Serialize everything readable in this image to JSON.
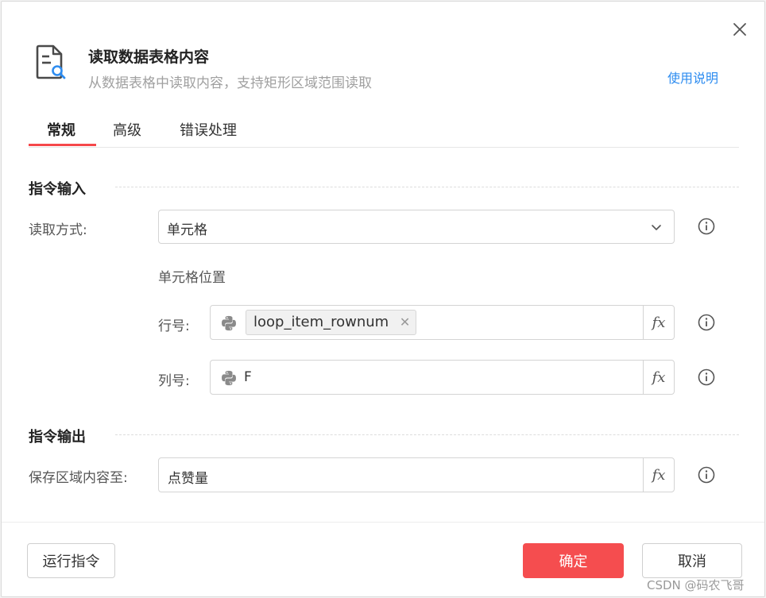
{
  "dialog": {
    "title": "读取数据表格内容",
    "subtitle": "从数据表格中读取内容，支持矩形区域范围读取",
    "help_link": "使用说明"
  },
  "tabs": [
    {
      "label": "常规",
      "active": true
    },
    {
      "label": "高级",
      "active": false
    },
    {
      "label": "错误处理",
      "active": false
    }
  ],
  "input_section": {
    "title": "指令输入",
    "read_mode": {
      "label": "读取方式:",
      "value": "单元格"
    },
    "cell_position_label": "单元格位置",
    "row": {
      "label": "行号:",
      "tag": "loop_item_rownum",
      "fx": "fx"
    },
    "column": {
      "label": "列号:",
      "value": "F",
      "fx": "fx"
    }
  },
  "output_section": {
    "title": "指令输出",
    "save_to": {
      "label": "保存区域内容至:",
      "value": "点赞量",
      "fx": "fx"
    }
  },
  "footer": {
    "run_label": "运行指令",
    "ok_label": "确定",
    "cancel_label": "取消"
  },
  "watermark": "CSDN @码农飞哥",
  "colors": {
    "accent": "#f54d4f",
    "link": "#2d8cf0",
    "tab_indicator": "#f5474a"
  },
  "icons": [
    "close-icon",
    "document-search-icon",
    "chevron-down-icon",
    "python-icon",
    "info-icon",
    "fx-icon",
    "tag-close-icon"
  ]
}
